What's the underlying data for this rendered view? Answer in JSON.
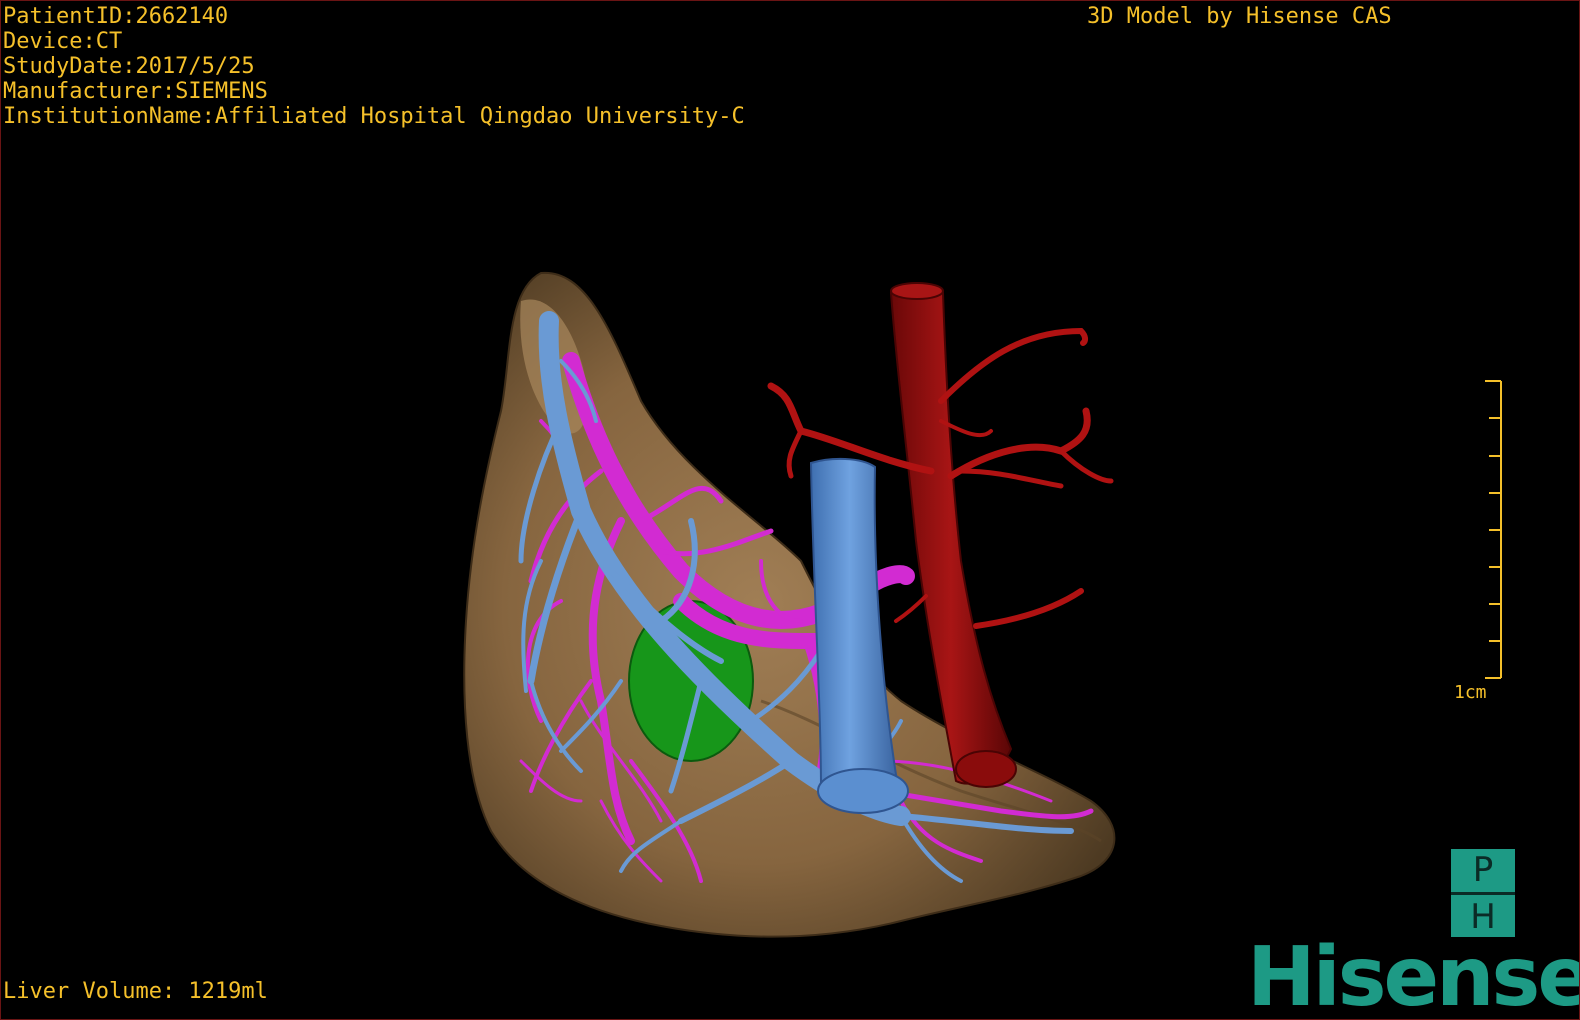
{
  "window": {
    "title": "3D Model by Hisense CAS"
  },
  "patient_info": [
    {
      "label": "PatientID",
      "value": "2662140"
    },
    {
      "label": "Device",
      "value": "CT"
    },
    {
      "label": "StudyDate",
      "value": "2017/5/25"
    },
    {
      "label": "Manufacturer",
      "value": "SIEMENS"
    },
    {
      "label": "InstitutionName",
      "value": "Affiliated Hospital Qingdao University-C"
    }
  ],
  "patient_info_text": [
    "PatientID:2662140",
    "Device:CT",
    "StudyDate:2017/5/25",
    "Manufacturer:SIEMENS",
    "InstitutionName:Affiliated Hospital Qingdao University-C"
  ],
  "measurements": {
    "liver_volume_text": "Liver Volume: 1219ml"
  },
  "scale_bar": {
    "label": "1cm",
    "ticks": 9
  },
  "badge": {
    "top_letter": "P",
    "bottom_letter": "H"
  },
  "brand": {
    "name": "Hisense"
  },
  "model_structures": [
    {
      "name": "liver",
      "color": "#8b6a45"
    },
    {
      "name": "portal-vein",
      "color": "#6a9ad4"
    },
    {
      "name": "hepatic-vein",
      "color": "#d22bd2"
    },
    {
      "name": "vena-cava",
      "color": "#5b8fd0"
    },
    {
      "name": "aorta",
      "color": "#9a1010"
    },
    {
      "name": "gallbladder",
      "color": "#19a019"
    }
  ],
  "colors": {
    "overlay_text": "#f5c02a",
    "background": "#000000",
    "brand_green": "#1d9a85"
  }
}
